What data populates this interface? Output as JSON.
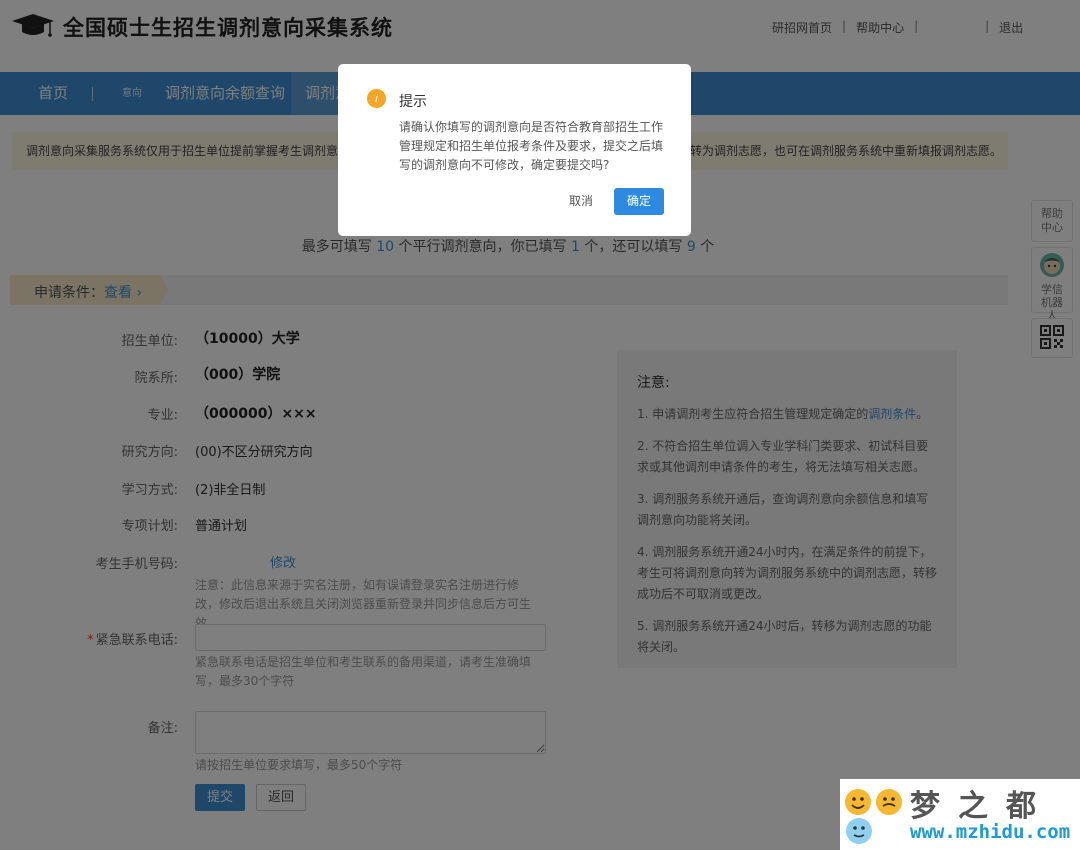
{
  "header": {
    "title": "全国硕士生招生调剂意向采集系统",
    "links": [
      "研招网首页",
      "帮助中心",
      "退出"
    ],
    "separator": "|"
  },
  "nav": {
    "home": "首页",
    "small_tag": "意向",
    "query": "调剂意向余额查询",
    "active": "调剂意"
  },
  "notice": {
    "left": "调剂意向采集服务系统仅用于招生单位提前掌握考生调剂意",
    "right": "转为调剂志愿，也可在调剂服务系统中重新填报调剂志愿。"
  },
  "count_line": {
    "p1": "最多可填写",
    "n1": "10",
    "p2": "个平行调剂意向，你已填写",
    "n2": "1",
    "p3": "个，还可以填写",
    "n3": "9",
    "p4": "个"
  },
  "conditions": {
    "label": "申请条件：",
    "link": "查看 ›"
  },
  "form": {
    "unit_label": "招生单位:",
    "unit_value": "（10000）大学",
    "dept_label": "院系所:",
    "dept_value": "（000）学院",
    "major_label": "专业:",
    "major_value": "（000000）×××",
    "direction_label": "研究方向:",
    "direction_value": "(00)不区分研究方向",
    "study_label": "学习方式:",
    "study_value": "(2)非全日制",
    "plan_label": "专项计划:",
    "plan_value": "普通计划",
    "phone_label": "考生手机号码:",
    "phone_edit": "修改",
    "phone_hint": "注意：此信息来源于实名注册，如有误请登录实名注册进行修改，修改后退出系统且关闭浏览器重新登录并同步信息后方可生效",
    "required_mark": "*",
    "emergency_label": "紧急联系电话:",
    "emergency_value": "",
    "emergency_hint": "紧急联系电话是招生单位和考生联系的备用渠道，请考生准确填写，最多30个字符",
    "remark_label": "备注:",
    "remark_value": "",
    "remark_hint": "请按招生单位要求填写，最多50个字符",
    "submit": "提交",
    "back": "返回"
  },
  "notes": {
    "title": "注意:",
    "item1_text": "1. 申请调剂考生应符合招生管理规定确定的",
    "item1_link": "调剂条件",
    "item1_end": "。",
    "item2": "2. 不符合招生单位调入专业学科门类要求、初试科目要求或其他调剂申请条件的考生，将无法填写相关志愿。",
    "item3": "3. 调剂服务系统开通后，查询调剂意向余额信息和填写调剂意向功能将关闭。",
    "item4": "4. 调剂服务系统开通24小时内，在满足条件的前提下，考生可将调剂意向转为调剂服务系统中的调剂志愿，转移成功后不可取消或更改。",
    "item5": "5. 调剂服务系统开通24小时后，转移为调剂志愿的功能将关闭。"
  },
  "side": {
    "help": "帮助中心",
    "robot": "学信机器人"
  },
  "modal": {
    "icon": "i",
    "title": "提示",
    "body": "请确认你填写的调剂意向是否符合教育部招生工作管理规定和招生单位报考条件及要求，提交之后填写的调剂意向不可修改，确定要提交吗?",
    "cancel": "取消",
    "ok": "确定"
  },
  "watermark": {
    "title": "梦之都",
    "url": "www.mzhidu.com"
  },
  "colors": {
    "primary": "#3f8fd3",
    "warning": "#f5a623",
    "notice_bg": "#fdf7e3"
  }
}
